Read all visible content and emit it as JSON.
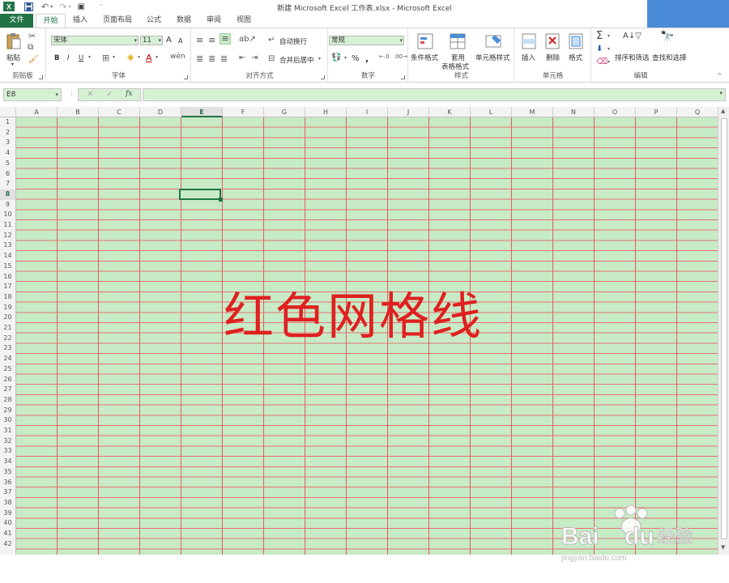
{
  "titlebar": {
    "title": "新建 Microsoft Excel 工作表.xlsx - Microsoft Excel",
    "brand_color": "#217346"
  },
  "tabs": [
    {
      "label": "文件"
    },
    {
      "label": "开始"
    },
    {
      "label": "插入"
    },
    {
      "label": "页面布局"
    },
    {
      "label": "公式"
    },
    {
      "label": "数据"
    },
    {
      "label": "审阅"
    },
    {
      "label": "视图"
    }
  ],
  "ribbon": {
    "clipboard": {
      "paste": "粘贴",
      "label": "剪贴板"
    },
    "font": {
      "font_name": "宋体",
      "font_size": "11",
      "bold": "B",
      "italic": "I",
      "underline": "U",
      "font_color_glyph": "A",
      "grow": "A",
      "shrink": "A",
      "label": "字体"
    },
    "alignment": {
      "wrap": "自动换行",
      "merge": "合并后居中",
      "label": "对齐方式"
    },
    "number": {
      "format": "常规",
      "percent": "%",
      "comma": ",",
      "label": "数字"
    },
    "styles": {
      "conditional": "条件格式",
      "table_1": "套用",
      "table_2": "表格格式",
      "cell_styles": "单元格样式",
      "label": "样式"
    },
    "cells": {
      "insert": "插入",
      "delete": "删除",
      "format": "格式",
      "label": "单元格"
    },
    "editing": {
      "sort": "排序和筛选",
      "find": "查找和选择",
      "label": "编辑"
    }
  },
  "formula_bar": {
    "name_box": "E8",
    "fx": "fx",
    "formula": ""
  },
  "sheet": {
    "columns": [
      "A",
      "B",
      "C",
      "D",
      "E",
      "F",
      "G",
      "H",
      "I",
      "J",
      "K",
      "L",
      "M",
      "N",
      "O",
      "P",
      "Q"
    ],
    "selected_column": "E",
    "selected_row": 8,
    "row_count": 42,
    "cell_fill": "#c6ebc6",
    "gridline_color": "#e06060",
    "big_text": "红色网格线"
  },
  "watermark": {
    "brand": "Bai",
    "brand2": "du",
    "cn": "经验",
    "url": "jingyan.baidu.com"
  }
}
